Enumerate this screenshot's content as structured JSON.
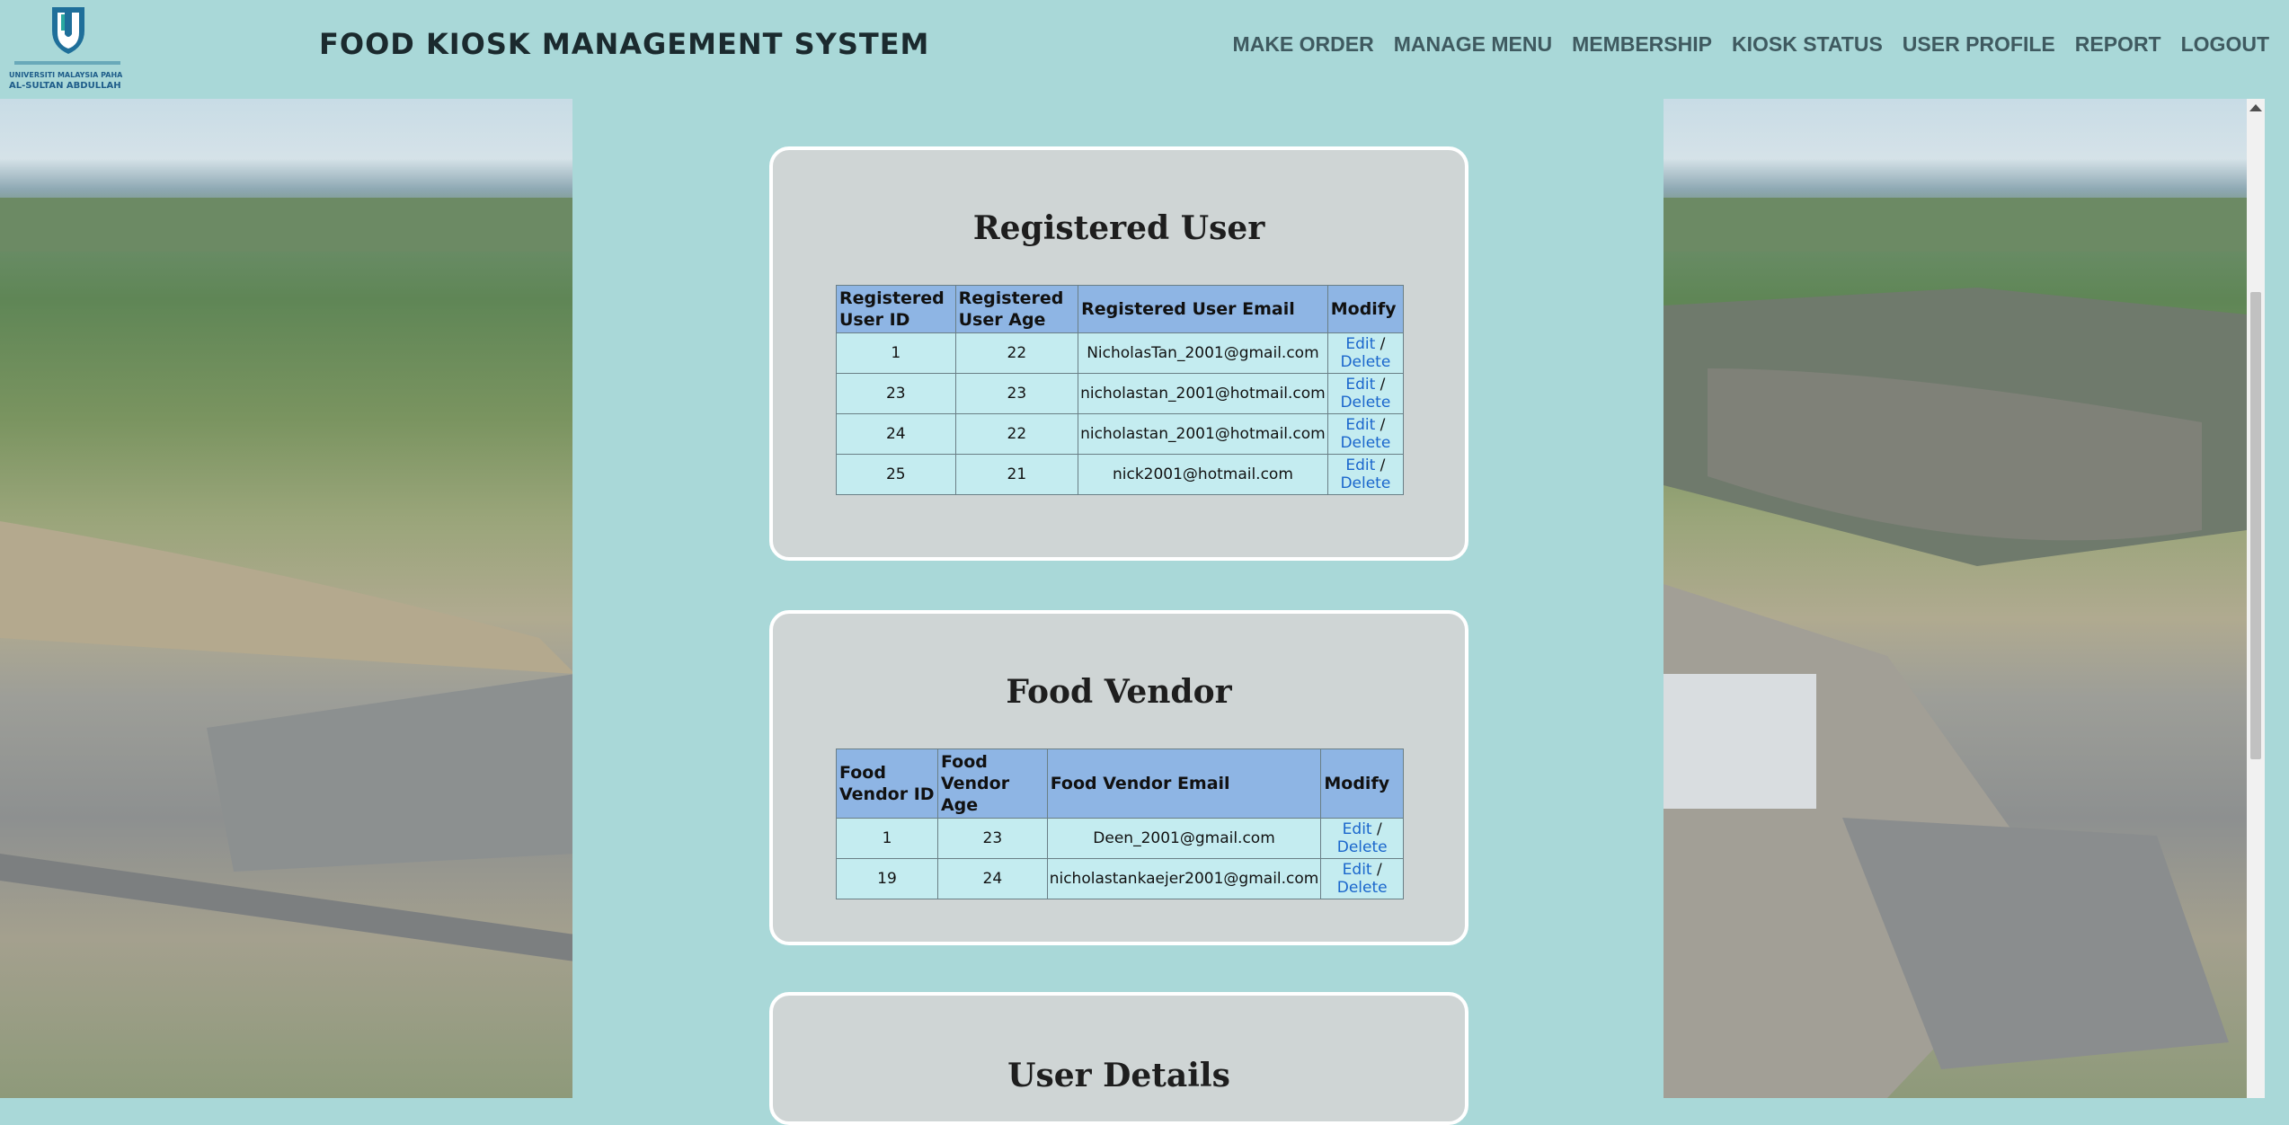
{
  "header": {
    "logo_alt": "UNIVERSITI MALAYSIA PAHANG AL-SULTAN ABDULLAH",
    "logo_line1": "UNIVERSITI MALAYSIA PAHANG",
    "logo_line2": "AL-SULTAN ABDULLAH",
    "title": "FOOD KIOSK MANAGEMENT SYSTEM",
    "nav": [
      "MAKE ORDER",
      "MANAGE MENU",
      "MEMBERSHIP",
      "KIOSK STATUS",
      "USER PROFILE",
      "REPORT",
      "LOGOUT"
    ]
  },
  "registered": {
    "title": "Registered User",
    "headers": [
      "Registered User ID",
      "Registered User Age",
      "Registered User Email",
      "Modify"
    ],
    "rows": [
      {
        "id": "1",
        "age": "22",
        "email": "NicholasTan_2001@gmail.com"
      },
      {
        "id": "23",
        "age": "23",
        "email": "nicholastan_2001@hotmail.com"
      },
      {
        "id": "24",
        "age": "22",
        "email": "nicholastan_2001@hotmail.com"
      },
      {
        "id": "25",
        "age": "21",
        "email": "nick2001@hotmail.com"
      }
    ]
  },
  "vendor": {
    "title": "Food Vendor",
    "headers": [
      "Food Vendor ID",
      "Food Vendor Age",
      "Food Vendor Email",
      "Modify"
    ],
    "rows": [
      {
        "id": "1",
        "age": "23",
        "email": "Deen_2001@gmail.com"
      },
      {
        "id": "19",
        "age": "24",
        "email": "nicholastankaejer2001@gmail.com"
      }
    ]
  },
  "details": {
    "title": "User Details"
  },
  "actions": {
    "edit": "Edit",
    "sep": "/",
    "delete": "Delete"
  },
  "colors": {
    "page": "#a9d8d8",
    "card": "#cfd5d5",
    "th": "#8eb5e4",
    "td": "#c4ecf0",
    "link": "#1a66cc"
  }
}
